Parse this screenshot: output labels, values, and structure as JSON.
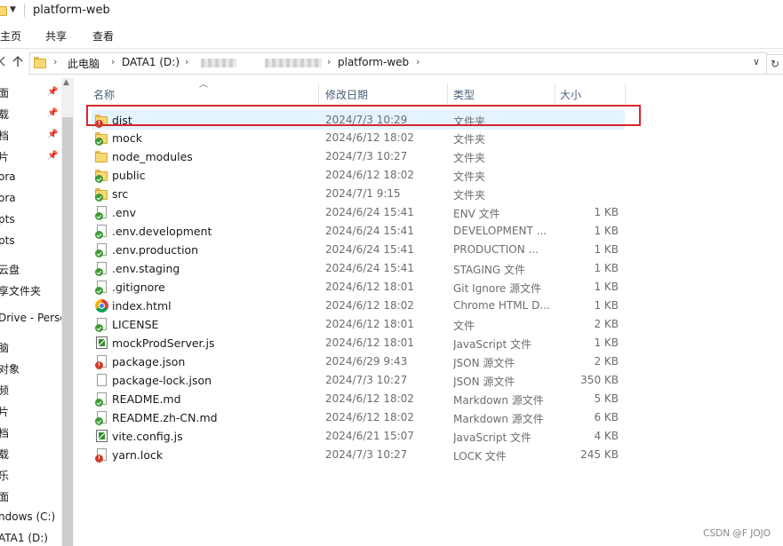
{
  "window": {
    "title": "platform-web"
  },
  "ribbon": {
    "tabs": [
      "主页",
      "共享",
      "查看"
    ]
  },
  "address": {
    "back_icon": "back-arrow-icon",
    "up_icon": "up-arrow-icon",
    "crumbs": [
      "此电脑",
      "DATA1 (D:)",
      "platform-web"
    ],
    "refresh_icon": "refresh-icon"
  },
  "nav_pane": {
    "items": [
      "面",
      "载",
      "档",
      "片",
      "ora",
      "ora",
      "pts",
      "pts",
      "云盘",
      "享文件夹",
      "Drive - Perso",
      "脑",
      "对象",
      "频",
      "片",
      "档",
      "载",
      "乐",
      "面",
      "ndows (C:)",
      "ATA1 (D:)"
    ]
  },
  "columns": {
    "name": "名称",
    "date": "修改日期",
    "type": "类型",
    "size": "大小"
  },
  "files": [
    {
      "name": "dist",
      "date": "2024/7/3 10:29",
      "type": "文件夹",
      "size": "",
      "icon": "folder-error"
    },
    {
      "name": "mock",
      "date": "2024/6/12 18:02",
      "type": "文件夹",
      "size": "",
      "icon": "folder-ok"
    },
    {
      "name": "node_modules",
      "date": "2024/7/3 10:27",
      "type": "文件夹",
      "size": "",
      "icon": "folder"
    },
    {
      "name": "public",
      "date": "2024/6/12 18:02",
      "type": "文件夹",
      "size": "",
      "icon": "folder-ok"
    },
    {
      "name": "src",
      "date": "2024/7/1 9:15",
      "type": "文件夹",
      "size": "",
      "icon": "folder-ok"
    },
    {
      "name": ".env",
      "date": "2024/6/24 15:41",
      "type": "ENV 文件",
      "size": "1 KB",
      "icon": "file-ok"
    },
    {
      "name": ".env.development",
      "date": "2024/6/24 15:41",
      "type": "DEVELOPMENT ...",
      "size": "1 KB",
      "icon": "file-ok"
    },
    {
      "name": ".env.production",
      "date": "2024/6/24 15:41",
      "type": "PRODUCTION ...",
      "size": "1 KB",
      "icon": "file-ok"
    },
    {
      "name": ".env.staging",
      "date": "2024/6/24 15:41",
      "type": "STAGING 文件",
      "size": "1 KB",
      "icon": "file-ok"
    },
    {
      "name": ".gitignore",
      "date": "2024/6/12 18:01",
      "type": "Git Ignore 源文件",
      "size": "1 KB",
      "icon": "file-ok"
    },
    {
      "name": "index.html",
      "date": "2024/6/12 18:02",
      "type": "Chrome HTML D...",
      "size": "1 KB",
      "icon": "chrome"
    },
    {
      "name": "LICENSE",
      "date": "2024/6/12 18:01",
      "type": "文件",
      "size": "2 KB",
      "icon": "file-ok"
    },
    {
      "name": "mockProdServer.js",
      "date": "2024/6/12 18:01",
      "type": "JavaScript 文件",
      "size": "1 KB",
      "icon": "js"
    },
    {
      "name": "package.json",
      "date": "2024/6/29 9:43",
      "type": "JSON 源文件",
      "size": "2 KB",
      "icon": "file-error"
    },
    {
      "name": "package-lock.json",
      "date": "2024/7/3 10:27",
      "type": "JSON 源文件",
      "size": "350 KB",
      "icon": "file"
    },
    {
      "name": "README.md",
      "date": "2024/6/12 18:02",
      "type": "Markdown 源文件",
      "size": "5 KB",
      "icon": "file-ok"
    },
    {
      "name": "README.zh-CN.md",
      "date": "2024/6/12 18:02",
      "type": "Markdown 源文件",
      "size": "6 KB",
      "icon": "file-ok"
    },
    {
      "name": "vite.config.js",
      "date": "2024/6/21 15:07",
      "type": "JavaScript 文件",
      "size": "4 KB",
      "icon": "js"
    },
    {
      "name": "yarn.lock",
      "date": "2024/7/3 10:27",
      "type": "LOCK 文件",
      "size": "245 KB",
      "icon": "file-error"
    }
  ],
  "selected_index": 0,
  "highlight_color": "#d9262c",
  "watermark": "CSDN @F JOJO"
}
